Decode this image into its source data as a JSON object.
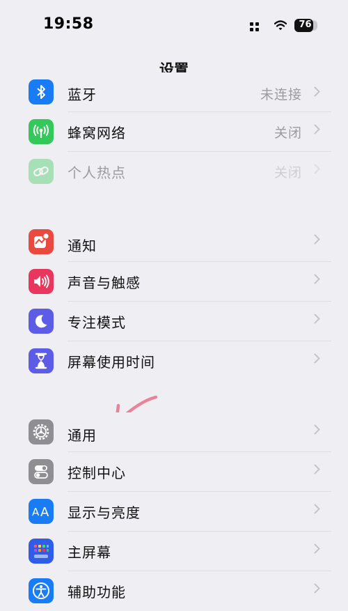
{
  "status_bar": {
    "time": "19:58",
    "battery": "76"
  },
  "nav": {
    "title": "设置"
  },
  "group1": [
    {
      "label": "蓝牙",
      "value": "未连接",
      "icon": "bluetooth-icon",
      "color": "#1a7cf5"
    },
    {
      "label": "蜂窝网络",
      "value": "关闭",
      "icon": "cellular-icon",
      "color": "#34c759"
    },
    {
      "label": "个人热点",
      "value": "关闭",
      "icon": "hotspot-icon",
      "color": "#34c759"
    }
  ],
  "group2": [
    {
      "label": "通知",
      "icon": "notifications-icon",
      "color": "#e84a3f"
    },
    {
      "label": "声音与触感",
      "icon": "sound-icon",
      "color": "#e8365c"
    },
    {
      "label": "专注模式",
      "icon": "moon-icon",
      "color": "#5d5ce6"
    },
    {
      "label": "屏幕使用时间",
      "icon": "hourglass-icon",
      "color": "#5d5ce6"
    }
  ],
  "group3": [
    {
      "label": "通用",
      "icon": "gear-icon",
      "color": "#8e8e93"
    },
    {
      "label": "控制中心",
      "icon": "toggles-icon",
      "color": "#8e8e93"
    },
    {
      "label": "显示与亮度",
      "icon": "text-size-icon",
      "color": "#1a7cf5"
    },
    {
      "label": "主屏幕",
      "icon": "home-grid-icon",
      "color": "#2f5de8"
    },
    {
      "label": "辅助功能",
      "icon": "accessibility-icon",
      "color": "#1a7cf5"
    }
  ]
}
